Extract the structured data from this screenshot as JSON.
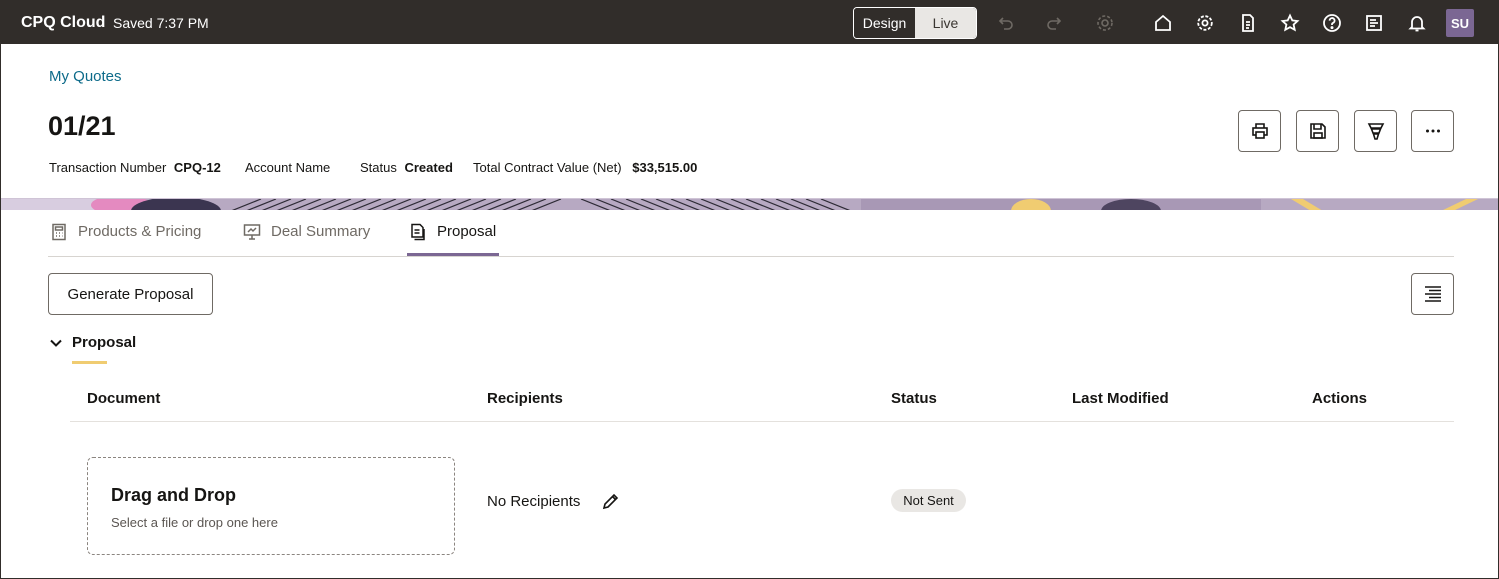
{
  "topbar": {
    "app_title": "CPQ Cloud",
    "saved_status": "Saved 7:37 PM",
    "mode_design": "Design",
    "mode_live": "Live",
    "icons": [
      "undo-icon",
      "redo-icon",
      "settings-disabled-icon",
      "home-icon",
      "gear-icon",
      "document-icon",
      "star-icon",
      "help-icon",
      "report-icon",
      "bell-icon"
    ],
    "avatar_initials": "SU"
  },
  "header": {
    "breadcrumb": "My Quotes",
    "title": "01/21",
    "transaction_number_label": "Transaction Number",
    "transaction_number_value": "CPQ-12",
    "account_name_label": "Account Name",
    "status_label": "Status",
    "status_value": "Created",
    "total_value_label": "Total Contract Value (Net)",
    "total_value_value": "$33,515.00",
    "actions": [
      "print-icon",
      "save-icon",
      "funnel-icon",
      "more-icon"
    ]
  },
  "tabs": [
    {
      "label": "Products & Pricing",
      "icon": "calculator-icon",
      "active": false
    },
    {
      "label": "Deal Summary",
      "icon": "presentation-icon",
      "active": false
    },
    {
      "label": "Proposal",
      "icon": "document-icon",
      "active": true
    }
  ],
  "toolbar": {
    "generate_label": "Generate Proposal"
  },
  "section": {
    "title": "Proposal",
    "columns": [
      "Document",
      "Recipients",
      "Status",
      "Last Modified",
      "Actions"
    ],
    "dropzone_title": "Drag and Drop",
    "dropzone_subtitle": "Select a file or drop one here",
    "recipients": "No Recipients",
    "status": "Not Sent"
  },
  "colors": {
    "topbar": "#312d2a",
    "link": "#0d6b8a",
    "active_tab": "#7b6793",
    "section_accent": "#f0cc71"
  }
}
